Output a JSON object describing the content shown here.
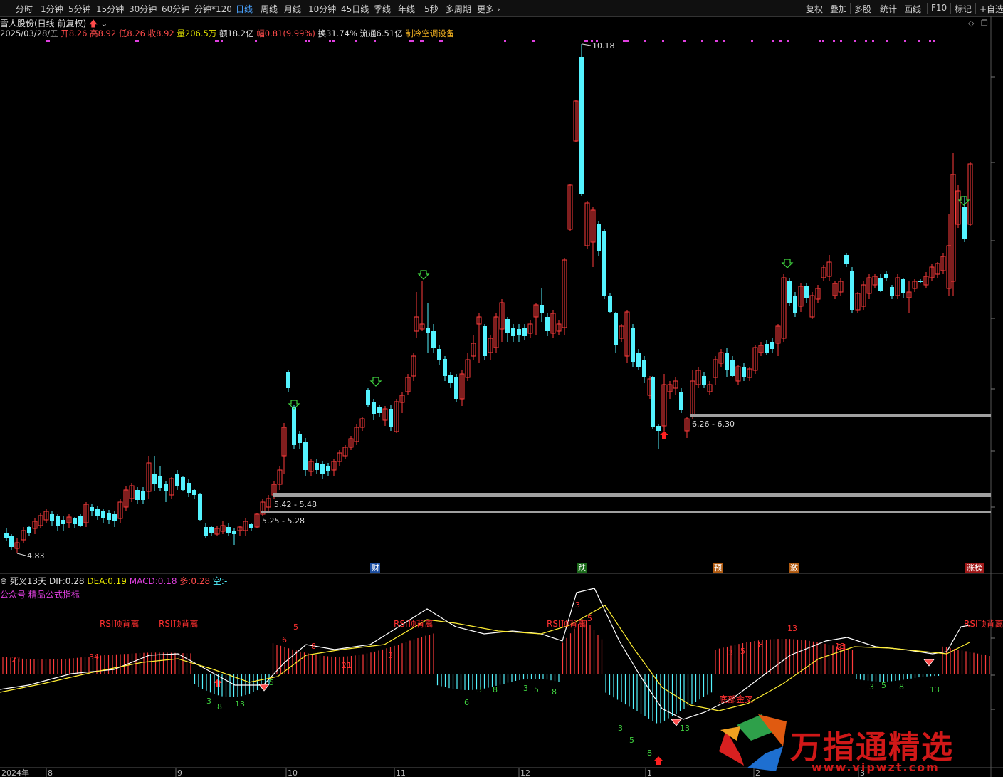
{
  "toolbar": {
    "periods": [
      "分时",
      "1分钟",
      "5分钟",
      "15分钟",
      "30分钟",
      "60分钟",
      "分钟*120",
      "日线",
      "周线",
      "月线",
      "10分钟",
      "45日线",
      "季线",
      "年线",
      "5秒",
      "多周期",
      "更多"
    ],
    "active_period": "日线",
    "actions": [
      "复权",
      "叠加",
      "多股",
      "统计",
      "画线",
      "F10",
      "标记",
      "+自选"
    ]
  },
  "stock": {
    "name": "雪人股份(日线 前复权)",
    "date": "2025/03/28/五",
    "open_label": "开",
    "open": "8.26",
    "high_label": "高",
    "high": "8.92",
    "low_label": "低",
    "low": "8.26",
    "close_label": "收",
    "close": "8.92",
    "volume_label": "量",
    "volume": "206.5万",
    "amount_label": "额",
    "amount": "18.2亿",
    "change_label": "幅",
    "change": "0.81(9.99%)",
    "turnover_label": "换",
    "turnover": "31.74%",
    "float_label": "流通",
    "float_cap": "6.51亿",
    "industry": "制冷空调设备"
  },
  "price_annotations": {
    "high_marker": "10.18",
    "low_marker": "4.83",
    "zone1": "5.42 - 5.48",
    "zone2": "5.25 - 5.28",
    "zone3": "6.26 - 6.30"
  },
  "event_tags": [
    "财",
    "跌",
    "预",
    "激",
    "涨榜"
  ],
  "indicator": {
    "name": "死叉13天",
    "dif_label": "DIF:",
    "dif": "0.28",
    "dea_label": "DEA:",
    "dea": "0.19",
    "macd_label": "MACD:",
    "macd": "0.18",
    "duo_label": "多:",
    "duo": "0.28",
    "kong_label": "空:",
    "kong": "-",
    "subtitle": "公众号 精品公式指标",
    "rsi_label": "RSI顶背离",
    "cross_label": "底部金叉",
    "counts": [
      "21",
      "34",
      "3",
      "5",
      "6",
      "8",
      "13",
      "21",
      "3",
      "5",
      "3",
      "6",
      "8",
      "3",
      "5",
      "8",
      "3",
      "5",
      "8",
      "13",
      "3",
      "5",
      "8",
      "13",
      "21",
      "3",
      "5",
      "8",
      "13",
      "3",
      "5",
      "8",
      "13"
    ]
  },
  "axis": {
    "year": "2024年",
    "months": [
      "8",
      "9",
      "10",
      "11",
      "12",
      "1",
      "2",
      "3"
    ]
  },
  "watermark": {
    "text": "万指通精选",
    "url": "www.vipwzt.com"
  },
  "colors": {
    "up": "#ff3b3b",
    "down": "#54f3ff",
    "dif": "#ffffff",
    "dea": "#ffee33",
    "zone": "#a0a0a0"
  }
}
